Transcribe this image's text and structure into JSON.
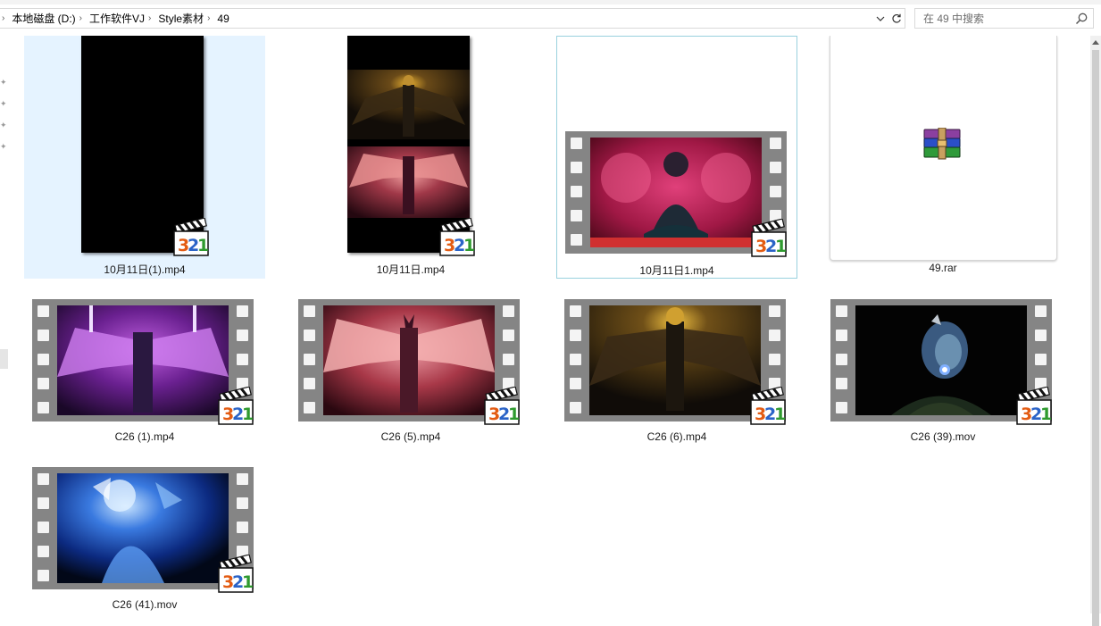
{
  "breadcrumb": {
    "items": [
      "本地磁盘 (D:)",
      "工作软件VJ",
      "Style素材",
      "49"
    ]
  },
  "search": {
    "placeholder": "在 49 中搜索"
  },
  "files": [
    {
      "name": "10月11日(1).mp4",
      "kind": "video-portrait",
      "selected": true
    },
    {
      "name": "10月11日.mp4",
      "kind": "video-portrait"
    },
    {
      "name": "10月11日1.mp4",
      "kind": "video-film",
      "focused": true
    },
    {
      "name": "49.rar",
      "kind": "archive"
    },
    {
      "name": "C26 (1).mp4",
      "kind": "video-film"
    },
    {
      "name": "C26 (5).mp4",
      "kind": "video-film"
    },
    {
      "name": "C26 (6).mp4",
      "kind": "video-film"
    },
    {
      "name": "C26 (39).mov",
      "kind": "video-film"
    },
    {
      "name": "C26 (41).mov",
      "kind": "video-film"
    }
  ],
  "icons": {
    "badge": "media-player-321-icon",
    "archive": "winrar-archive-icon",
    "search": "search-icon",
    "refresh": "refresh-icon",
    "dropdown": "chevron-down-icon"
  },
  "colors": {
    "selection": "#e5f3ff",
    "focus_border": "#99d1de",
    "film_strip": "#858585"
  }
}
